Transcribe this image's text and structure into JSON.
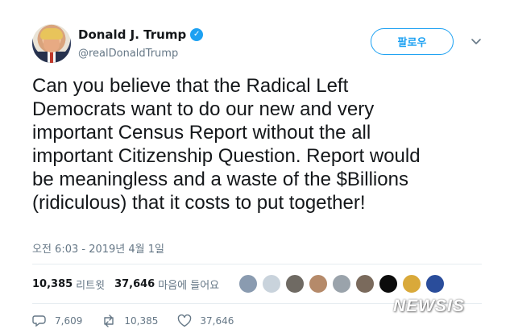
{
  "author": {
    "display_name": "Donald J. Trump",
    "handle": "@realDonaldTrump",
    "verified_icon": "verified-badge-icon"
  },
  "follow_button": {
    "label": "팔로우"
  },
  "tweet": {
    "text": "Can you believe that the Radical Left\nDemocrats want to do our new and very\nimportant Census Report without the all\nimportant Citizenship Question. Report would\nbe meaningless and a waste of the $Billions\n(ridiculous) that it costs to put together!",
    "timestamp": "오전 6:03 - 2019년 4월 1일"
  },
  "stats": {
    "retweets_count": "10,385",
    "retweets_label": "리트윗",
    "likes_count": "37,646",
    "likes_label": "마음에 들어요"
  },
  "likers": [
    {
      "icon": "liker-avatar-1",
      "color": "#8a9bb0"
    },
    {
      "icon": "liker-avatar-2",
      "color": "#c9d3dc"
    },
    {
      "icon": "liker-avatar-3",
      "color": "#6f6a63"
    },
    {
      "icon": "liker-avatar-4",
      "color": "#b58a6a"
    },
    {
      "icon": "liker-avatar-5",
      "color": "#9aa3ab"
    },
    {
      "icon": "liker-avatar-6",
      "color": "#7a6a5c"
    },
    {
      "icon": "liker-avatar-7",
      "color": "#0b0b0b"
    },
    {
      "icon": "liker-avatar-8",
      "color": "#d9a93a"
    },
    {
      "icon": "liker-avatar-9",
      "color": "#2a4d9b"
    }
  ],
  "actions": {
    "replies": "7,609",
    "retweets": "10,385",
    "likes": "37,646"
  },
  "watermark": "NEWSIS",
  "colors": {
    "accent": "#1da1f2",
    "text": "#14171a",
    "muted": "#657786",
    "divider": "#e6ecf0"
  }
}
